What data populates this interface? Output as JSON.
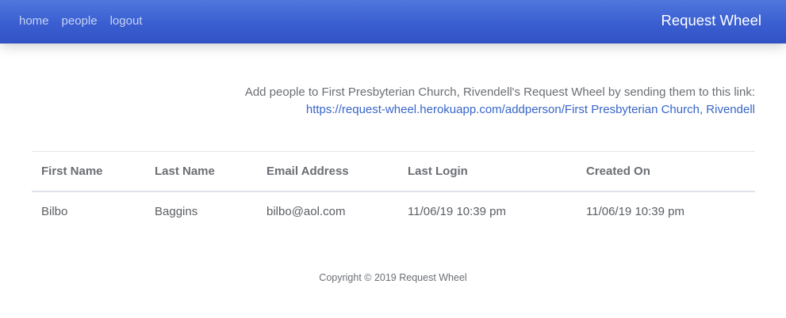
{
  "navbar": {
    "links": [
      "home",
      "people",
      "logout"
    ],
    "brand": "Request Wheel"
  },
  "info": {
    "text": "Add people to First Presbyterian Church, Rivendell's Request Wheel by sending them to this link:",
    "link": "https://request-wheel.herokuapp.com/addperson/First Presbyterian Church, Rivendell"
  },
  "table": {
    "headers": [
      "First Name",
      "Last Name",
      "Email Address",
      "Last Login",
      "Created On"
    ],
    "rows": [
      [
        "Bilbo",
        "Baggins",
        "bilbo@aol.com",
        "11/06/19 10:39 pm",
        "11/06/19 10:39 pm"
      ]
    ]
  },
  "footer": {
    "copyright": "Copyright © 2019 Request Wheel"
  },
  "colors": {
    "navbar": "#3a5ed0",
    "link": "#3765c8",
    "text": "#6b6e73"
  }
}
